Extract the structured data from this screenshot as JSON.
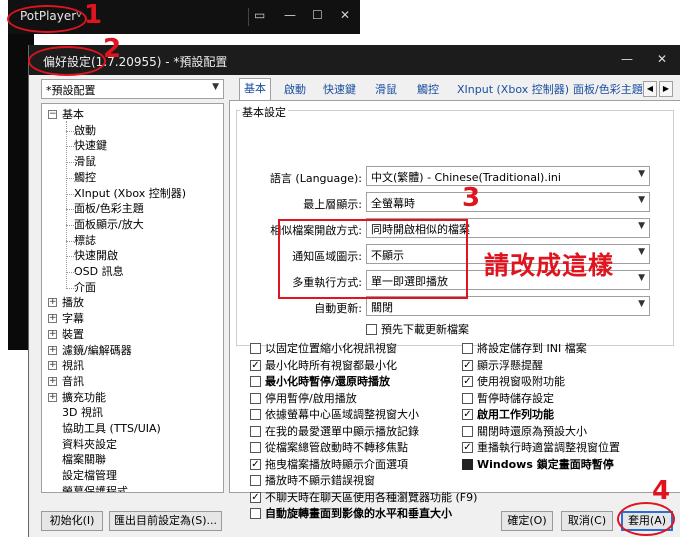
{
  "player": {
    "title": "PotPlayer",
    "chevron": "v",
    "pin_icon": "pin-icon",
    "controls": [
      "▭",
      "—",
      "☐",
      "✕"
    ]
  },
  "dialog": {
    "title": "偏好設定(1.7.20955) - *預設配置",
    "controls": [
      "—",
      "✕"
    ]
  },
  "profile": {
    "selected": "*預設配置"
  },
  "tree": {
    "items": [
      {
        "label": "基本",
        "level": 0,
        "box": "−"
      },
      {
        "label": "啟動",
        "level": 1
      },
      {
        "label": "快速鍵",
        "level": 1
      },
      {
        "label": "滑鼠",
        "level": 1
      },
      {
        "label": "觸控",
        "level": 1
      },
      {
        "label": "XInput (Xbox 控制器)",
        "level": 1
      },
      {
        "label": "面板/色彩主題",
        "level": 1
      },
      {
        "label": "面板顯示/放大",
        "level": 1
      },
      {
        "label": "標誌",
        "level": 1
      },
      {
        "label": "快速開啟",
        "level": 1
      },
      {
        "label": "OSD 訊息",
        "level": 1
      },
      {
        "label": "介面",
        "level": 1
      },
      {
        "label": "播放",
        "level": 0,
        "box": "+"
      },
      {
        "label": "字幕",
        "level": 0,
        "box": "+"
      },
      {
        "label": "裝置",
        "level": 0,
        "box": "+"
      },
      {
        "label": "濾鏡/編解碼器",
        "level": 0,
        "box": "+"
      },
      {
        "label": "視訊",
        "level": 0,
        "box": "+"
      },
      {
        "label": "音訊",
        "level": 0,
        "box": "+"
      },
      {
        "label": "擴充功能",
        "level": 0,
        "box": "+"
      },
      {
        "label": "3D 視訊",
        "level": 0
      },
      {
        "label": "協助工具 (TTS/UIA)",
        "level": 0
      },
      {
        "label": "資料夾設定",
        "level": 0
      },
      {
        "label": "檔案關聯",
        "level": 0
      },
      {
        "label": "設定檔管理",
        "level": 0
      },
      {
        "label": "螢幕保護程式",
        "level": 0
      }
    ]
  },
  "tabs": [
    "基本",
    "啟動",
    "快速鍵",
    "滑鼠",
    "觸控",
    "XInput (Xbox 控制器)",
    "面板/色彩主題"
  ],
  "basic": {
    "group_label": "基本設定",
    "fields": [
      {
        "label": "語言 (Language):",
        "value": "中文(繁體) - Chinese(Traditional).ini"
      },
      {
        "label": "最上層顯示:",
        "value": "全螢幕時"
      },
      {
        "label": "相似檔案開啟方式:",
        "value": "同時開啟相似的檔案"
      },
      {
        "label": "通知區域圖示:",
        "value": "不顯示"
      },
      {
        "label": "多重執行方式:",
        "value": "單一即選即播放"
      },
      {
        "label": "自動更新:",
        "value": "關閉"
      }
    ],
    "predownload": {
      "label": "預先下載更新檔案",
      "checked": false
    }
  },
  "left_checks": [
    {
      "label": "以固定位置縮小化視訊視窗",
      "checked": false,
      "bold": false
    },
    {
      "label": "最小化時所有視窗都最小化",
      "checked": true,
      "bold": false
    },
    {
      "label": "最小化時暫停/還原時播放",
      "checked": false,
      "bold": true
    },
    {
      "label": "停用暫停/啟用播放",
      "checked": false,
      "bold": false
    },
    {
      "label": "依據螢幕中心區域調整視窗大小",
      "checked": false,
      "bold": false
    },
    {
      "label": "在我的最愛選單中顯示播放記錄",
      "checked": false,
      "bold": false
    },
    {
      "label": "從檔案總管啟動時不轉移焦點",
      "checked": false,
      "bold": false
    },
    {
      "label": "拖曳檔案播放時顯示介面選項",
      "checked": true,
      "bold": false
    },
    {
      "label": "播放時不顯示錯誤視窗",
      "checked": false,
      "bold": false
    },
    {
      "label": "不聊天時在聊天區使用各種瀏覽器功能 (F9)",
      "checked": true,
      "bold": false
    },
    {
      "label": "自動旋轉畫面到影像的水平和垂直大小",
      "checked": false,
      "bold": true
    }
  ],
  "right_checks": [
    {
      "label": "將設定儲存到 INI 檔案",
      "checked": false,
      "bold": false
    },
    {
      "label": "顯示浮懸提醒",
      "checked": true,
      "bold": false
    },
    {
      "label": "使用視窗吸附功能",
      "checked": true,
      "bold": false
    },
    {
      "label": "暫停時儲存設定",
      "checked": false,
      "bold": false
    },
    {
      "label": "啟用工作列功能",
      "checked": true,
      "bold": true
    },
    {
      "label": "關閉時還原為預設大小",
      "checked": false,
      "bold": false
    },
    {
      "label": "重播執行時適當調整視窗位置",
      "checked": true,
      "bold": false
    },
    {
      "label": "Windows 鎖定畫面時暫停",
      "checked": true,
      "bold": true,
      "filled": true
    }
  ],
  "buttons": {
    "init": "初始化(I)",
    "export": "匯出目前設定為(S)...",
    "ok": "確定(O)",
    "cancel": "取消(C)",
    "apply": "套用(A)"
  },
  "annotations": {
    "n1": "1",
    "n2": "2",
    "n3": "3",
    "n4": "4",
    "note": "請改成這樣"
  },
  "colors": {
    "annotation": "#e0141e",
    "link_blue": "#1a4fa0",
    "titlebar": "#1c1c1c"
  }
}
